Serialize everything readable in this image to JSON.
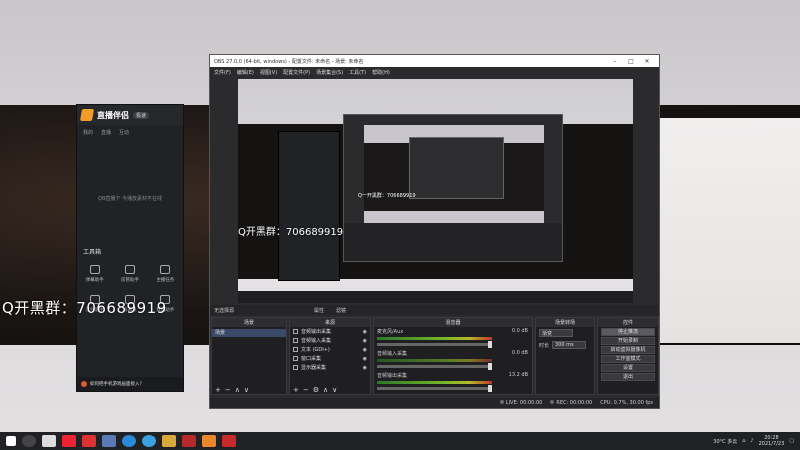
{
  "left_app": {
    "name": "直播伴侣",
    "version": "极速",
    "tabs": [
      "我的",
      "直播",
      "互动"
    ],
    "empty_hint": "QB直播下 今播放素材不在线",
    "toolbox_label": "工具箱",
    "tools": [
      "弹幕助手",
      "房管助手",
      "主播任务",
      "连线助手",
      "屏幕录",
      "数据助手"
    ],
    "footer_text": "如何把手机游戏画面接入?"
  },
  "overlay_text": "Q开黑群：706689919",
  "obs": {
    "title": "OBS 27.0.0 (64-bit, windows) - 配置文件: 未命名 - 场景: 未命名",
    "menu": [
      "文件(F)",
      "编辑(E)",
      "视图(V)",
      "配置文件(P)",
      "场景集合(S)",
      "工具(T)",
      "帮助(H)"
    ],
    "preview_qq": "Q开黑群：706689919",
    "preview_qq_small": "Q一开黑群：706689919",
    "transition_bar": {
      "status": "无选择源",
      "attr_label": "属性",
      "filter_label": "滤镜"
    },
    "docks": {
      "scenes": {
        "title": "场景",
        "items": [
          "场景"
        ]
      },
      "sources": {
        "title": "来源",
        "items": [
          "音频输出采集",
          "音频输入采集",
          "文本 (GDI+)",
          "窗口采集",
          "显示器采集"
        ]
      },
      "mixer": {
        "title": "混音器",
        "channels": [
          {
            "name": "麦克风/Aux",
            "db": "0.0 dB"
          },
          {
            "name": "音频输入采集",
            "db": "0.0 dB"
          },
          {
            "name": "音频输出采集",
            "db": "13.2 dB"
          }
        ]
      },
      "transitions": {
        "title": "场景转场",
        "type": "渐变",
        "duration_label": "时长",
        "duration_value": "300 ms"
      },
      "controls": {
        "title": "控件",
        "buttons": [
          "停止推流",
          "开始录制",
          "启动虚拟摄像机",
          "工作室模式",
          "设置",
          "退出"
        ]
      }
    },
    "status_bar": {
      "live": "LIVE: 00:00:00",
      "rec": "REC: 00:00:00",
      "cpu": "CPU: 0.7%, 30.00 fps"
    }
  },
  "taskbar": {
    "weather": "30°C 多云",
    "time": "20:28",
    "date": "2021/7/23"
  }
}
